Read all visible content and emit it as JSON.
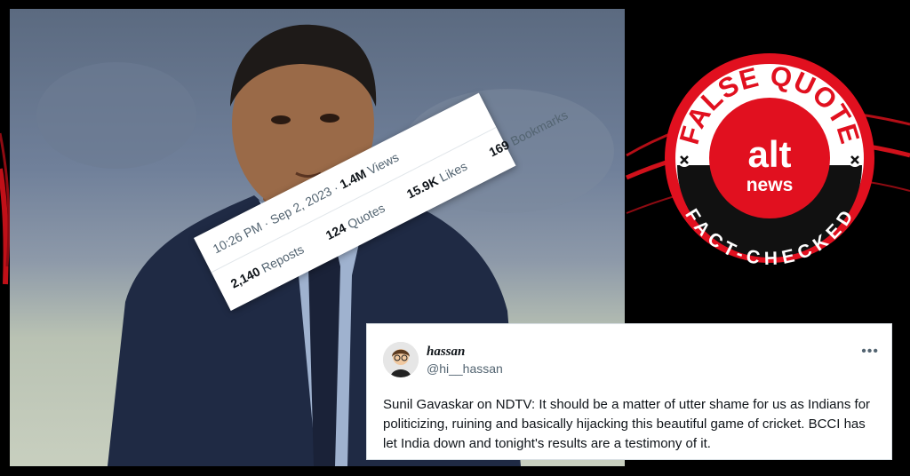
{
  "stats": {
    "time": "10:26 PM · Sep 2, 2023 · ",
    "views_count": "1.4M",
    "views_label": " Views",
    "reposts_count": "2,140",
    "reposts_label": " Reposts",
    "quotes_count": "124",
    "quotes_label": " Quotes",
    "likes_count": "15.9K",
    "likes_label": " Likes",
    "bookmarks_count": "169",
    "bookmarks_label": " Bookmarks"
  },
  "tweet": {
    "display_name": "hassan",
    "handle": "@hi__hassan",
    "more": "•••",
    "text": "Sunil Gavaskar on NDTV: It should be a matter of utter shame for us as Indians for politicizing, ruining and basically hijacking this beautiful game of cricket. BCCI has let India down and tonight's results are a testimony of it."
  },
  "badge": {
    "top_text": "FALSE QUOTE",
    "bottom_text": "FACT-CHECKED",
    "logo_top": "alt",
    "logo_bottom": "news",
    "colors": {
      "red": "#e1101f",
      "black": "#111111",
      "white": "#ffffff"
    }
  }
}
